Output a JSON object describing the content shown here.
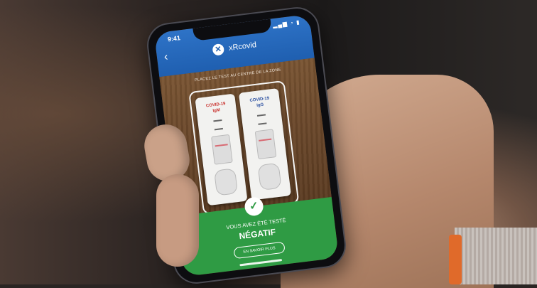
{
  "status_bar": {
    "time": "9:41",
    "icons": "▂▄▆ ◔ ▮"
  },
  "app": {
    "logo_glyph": "✕",
    "name": "xRcovid",
    "back_glyph": "‹"
  },
  "camera": {
    "instruction": "PLACEZ LE TEST AU CENTRE DE LA ZONE"
  },
  "tests": [
    {
      "title": "COVID-19",
      "type": "IgM"
    },
    {
      "title": "COVID-19",
      "type": "IgG"
    }
  ],
  "result": {
    "check_glyph": "✓",
    "line1": "VOUS AVEZ ÉTÉ TESTÉ",
    "line2": "NÉGATIF",
    "button": "EN SAVOIR PLUS"
  },
  "colors": {
    "app_blue": "#1f5fb0",
    "result_green": "#2f9b44",
    "test_red": "#c9302c",
    "test_blue": "#2a4fa0"
  }
}
